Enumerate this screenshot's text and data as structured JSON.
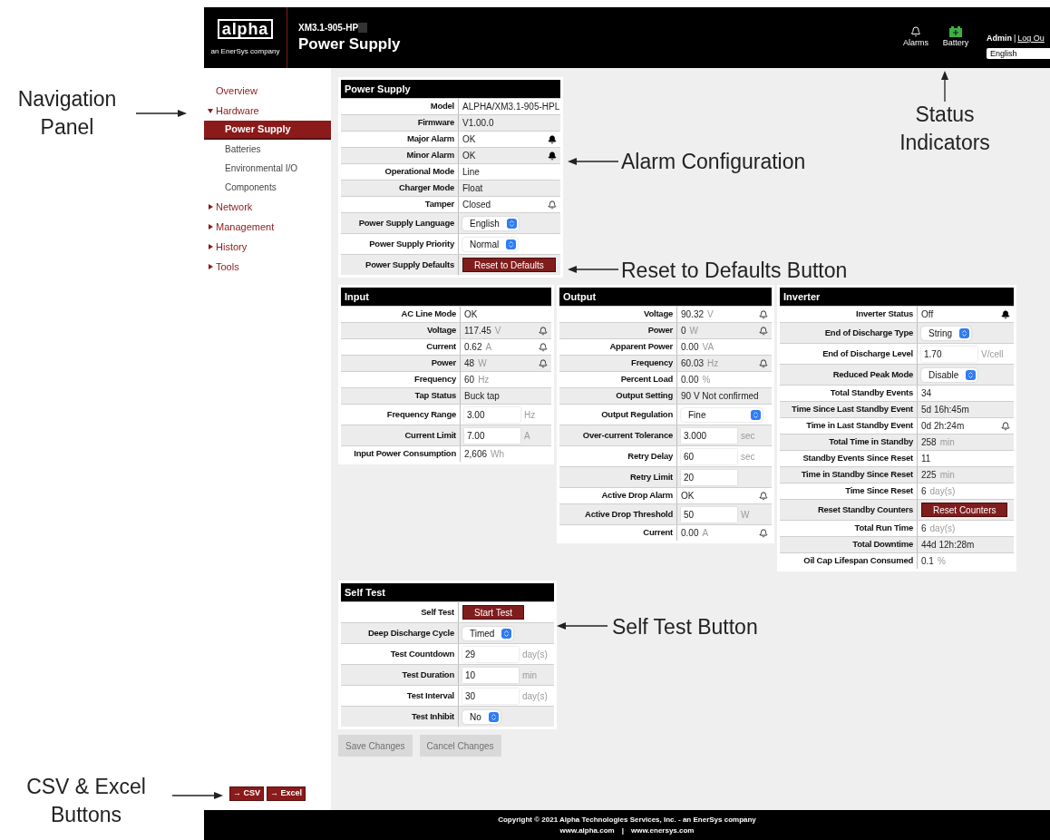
{
  "annotations": [
    {
      "text": "Navigation Panel",
      "kind": "right"
    },
    {
      "text": "Status Indicators",
      "kind": "up"
    },
    {
      "text": "Alarm Configuration",
      "kind": "left"
    },
    {
      "text": "Reset to Defaults Button",
      "kind": "left"
    },
    {
      "text": "Self Test Button",
      "kind": "left"
    },
    {
      "text": "CSV & Excel Buttons",
      "kind": "right"
    }
  ],
  "header": {
    "logo": "alpha",
    "tagline": "an EnerSys company",
    "model": "XM3.1-905-HP",
    "title": "Power Supply",
    "status": [
      {
        "label": "Alarms",
        "kind": "bell"
      },
      {
        "label": "Battery",
        "kind": "battery"
      }
    ],
    "user": "Admin",
    "separator": "|",
    "logout": "Log Ou",
    "language": "English"
  },
  "nav": {
    "items": [
      {
        "label": "Overview",
        "kind": "link",
        "selected": false
      },
      {
        "label": "Hardware",
        "kind": "group",
        "expanded": true,
        "selected": false,
        "children": [
          {
            "label": "Power Supply",
            "selected": true
          },
          {
            "label": "Batteries",
            "selected": false
          },
          {
            "label": "Environmental I/O",
            "selected": false
          },
          {
            "label": "Components",
            "selected": false
          }
        ]
      },
      {
        "label": "Network",
        "kind": "group",
        "expanded": false,
        "selected": false
      },
      {
        "label": "Management",
        "kind": "group",
        "expanded": false,
        "selected": false
      },
      {
        "label": "History",
        "kind": "group",
        "expanded": false,
        "selected": false
      },
      {
        "label": "Tools",
        "kind": "group",
        "expanded": false,
        "selected": false
      }
    ],
    "exports": [
      "→ CSV",
      "→ Excel"
    ]
  },
  "panels": [
    {
      "title": "Power Supply",
      "kind": "power",
      "rows": [
        {
          "label": "Model",
          "kind": "text",
          "value": "ALPHA/XM3.1-905-HPL"
        },
        {
          "label": "Firmware",
          "kind": "text",
          "value": "V1.00.0"
        },
        {
          "label": "Major Alarm",
          "kind": "text",
          "value": "OK",
          "bell": {
            "filled": true
          }
        },
        {
          "label": "Minor Alarm",
          "kind": "text",
          "value": "OK",
          "bell": {
            "filled": true
          }
        },
        {
          "label": "Operational Mode",
          "kind": "text",
          "value": "Line"
        },
        {
          "label": "Charger Mode",
          "kind": "text",
          "value": "Float"
        },
        {
          "label": "Tamper",
          "kind": "text",
          "value": "Closed",
          "bell": {
            "filled": false
          }
        },
        {
          "label": "Power Supply Language",
          "kind": "select",
          "value": "English"
        },
        {
          "label": "Power Supply Priority",
          "kind": "select",
          "value": "Normal"
        },
        {
          "label": "Power Supply Defaults",
          "kind": "button",
          "value": "Reset to Defaults"
        }
      ]
    },
    {
      "title": "Input",
      "kind": "input",
      "rows": [
        {
          "label": "AC Line Mode",
          "kind": "text",
          "value": "OK"
        },
        {
          "label": "Voltage",
          "kind": "text",
          "value": "117.45",
          "unit": "V",
          "bell": {
            "filled": false
          }
        },
        {
          "label": "Current",
          "kind": "text",
          "value": "0.62",
          "unit": "A",
          "bell": {
            "filled": false
          }
        },
        {
          "label": "Power",
          "kind": "text",
          "value": "48",
          "unit": "W",
          "bell": {
            "filled": false
          }
        },
        {
          "label": "Frequency",
          "kind": "text",
          "value": "60",
          "unit": "Hz"
        },
        {
          "label": "Tap Status",
          "kind": "text",
          "value": "Buck tap"
        },
        {
          "label": "Frequency Range",
          "kind": "input",
          "value": "3.00",
          "unit": "Hz"
        },
        {
          "label": "Current Limit",
          "kind": "input",
          "value": "7.00",
          "unit": "A"
        },
        {
          "label": "Input Power Consumption",
          "kind": "text",
          "value": "2,606",
          "unit": "Wh"
        }
      ]
    },
    {
      "title": "Output",
      "kind": "output",
      "rows": [
        {
          "label": "Voltage",
          "kind": "text",
          "value": "90.32",
          "unit": "V",
          "bell": {
            "filled": false
          }
        },
        {
          "label": "Power",
          "kind": "text",
          "value": "0",
          "unit": "W",
          "bell": {
            "filled": false
          }
        },
        {
          "label": "Apparent Power",
          "kind": "text",
          "value": "0.00",
          "unit": "VA"
        },
        {
          "label": "Frequency",
          "kind": "text",
          "value": "60.03",
          "unit": "Hz",
          "bell": {
            "filled": false
          }
        },
        {
          "label": "Percent Load",
          "kind": "text",
          "value": "0.00",
          "unit": "%"
        },
        {
          "label": "Output Setting",
          "kind": "text",
          "value": "90 V Not confirmed"
        },
        {
          "label": "Output Regulation",
          "kind": "select",
          "value": "Fine"
        },
        {
          "label": "Over-current Tolerance",
          "kind": "input",
          "value": "3.000",
          "unit": "sec"
        },
        {
          "label": "Retry Delay",
          "kind": "input",
          "value": "60",
          "unit": "sec"
        },
        {
          "label": "Retry Limit",
          "kind": "input",
          "value": "20"
        },
        {
          "label": "Active Drop Alarm",
          "kind": "text",
          "value": "OK",
          "bell": {
            "filled": false
          }
        },
        {
          "label": "Active Drop Threshold",
          "kind": "input",
          "value": "50",
          "unit": "W"
        },
        {
          "label": "Current",
          "kind": "text",
          "value": "0.00",
          "unit": "A",
          "bell": {
            "filled": false
          }
        }
      ]
    },
    {
      "title": "Inverter",
      "kind": "inverter",
      "rows": [
        {
          "label": "Inverter Status",
          "kind": "text",
          "value": "Off",
          "bell": {
            "filled": true
          }
        },
        {
          "label": "End of Discharge Type",
          "kind": "select",
          "value": "String"
        },
        {
          "label": "End of Discharge Level",
          "kind": "input",
          "value": "1.70",
          "unit": "V/cell"
        },
        {
          "label": "Reduced Peak Mode",
          "kind": "select",
          "value": "Disable"
        },
        {
          "label": "Total Standby Events",
          "kind": "text",
          "value": "34"
        },
        {
          "label": "Time Since Last Standby Event",
          "kind": "text",
          "value": "5d 16h:45m"
        },
        {
          "label": "Time in Last Standby Event",
          "kind": "text",
          "value": "0d 2h:24m",
          "bell": {
            "filled": false
          }
        },
        {
          "label": "Total Time in Standby",
          "kind": "text",
          "value": "258",
          "unit": "min"
        },
        {
          "label": "Standby Events Since Reset",
          "kind": "text",
          "value": "11"
        },
        {
          "label": "Time in Standby Since Reset",
          "kind": "text",
          "value": "225",
          "unit": "min"
        },
        {
          "label": "Time Since Reset",
          "kind": "text",
          "value": "6",
          "unit": "day(s)"
        },
        {
          "label": "Reset Standby Counters",
          "kind": "button",
          "value": "Reset Counters"
        },
        {
          "label": "Total Run Time",
          "kind": "text",
          "value": "6",
          "unit": "day(s)"
        },
        {
          "label": "Total Downtime",
          "kind": "text",
          "value": "44d 12h:28m"
        },
        {
          "label": "Oil Cap Lifespan Consumed",
          "kind": "text",
          "value": "0.1",
          "unit": "%"
        }
      ]
    },
    {
      "title": "Self Test",
      "kind": "selftest",
      "rows": [
        {
          "label": "Self Test",
          "kind": "button",
          "value": "Start Test"
        },
        {
          "label": "Deep Discharge Cycle",
          "kind": "select",
          "value": "Timed"
        },
        {
          "label": "Test Countdown",
          "kind": "input",
          "value": "29",
          "unit": "day(s)"
        },
        {
          "label": "Test Duration",
          "kind": "input",
          "value": "10",
          "unit": "min"
        },
        {
          "label": "Test Interval",
          "kind": "input",
          "value": "30",
          "unit": "day(s)"
        },
        {
          "label": "Test Inhibit",
          "kind": "select",
          "value": "No"
        }
      ]
    }
  ],
  "actions": [
    {
      "label": "Save Changes",
      "disabled": true
    },
    {
      "label": "Cancel Changes",
      "disabled": true
    }
  ],
  "footer": {
    "copyright": "Copyright © 2021 Alpha Technologies Services, Inc. - an EnerSys company",
    "links": [
      "www.alpha.com",
      "www.enersys.com"
    ],
    "separator": "|"
  }
}
